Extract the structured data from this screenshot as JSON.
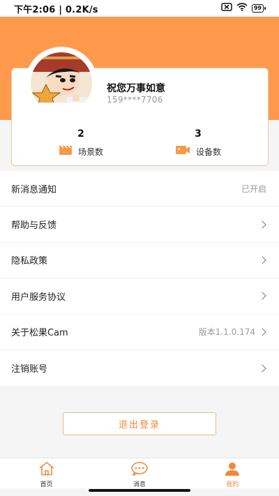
{
  "status_bar": {
    "time_speed": "下午2:06 | 0.2K/s",
    "battery": "99"
  },
  "colors": {
    "accent": "#ff9a4d",
    "accent_text": "#ee8a3a"
  },
  "profile": {
    "name": "祝您万事如意",
    "phone": "159****7706"
  },
  "stats": {
    "scenes": {
      "value": "2",
      "label": "场景数",
      "icon": "clapperboard-icon"
    },
    "devices": {
      "value": "3",
      "label": "设备数",
      "icon": "video-camera-icon"
    }
  },
  "menu": {
    "items": [
      {
        "label": "新消息通知",
        "value": "已开启",
        "chevron": false
      },
      {
        "label": "帮助与反馈",
        "value": "",
        "chevron": true
      },
      {
        "label": "隐私政策",
        "value": "",
        "chevron": true
      },
      {
        "label": "用户服务协议",
        "value": "",
        "chevron": true
      },
      {
        "label": "关于松果Cam",
        "value": "版本1.1.0.174",
        "chevron": true
      },
      {
        "label": "注销账号",
        "value": "",
        "chevron": true
      }
    ]
  },
  "logout_label": "退出登录",
  "tabs": [
    {
      "label": "首页",
      "icon": "home-icon",
      "active": false
    },
    {
      "label": "消息",
      "icon": "message-icon",
      "active": false
    },
    {
      "label": "我的",
      "icon": "user-icon",
      "active": true
    }
  ]
}
